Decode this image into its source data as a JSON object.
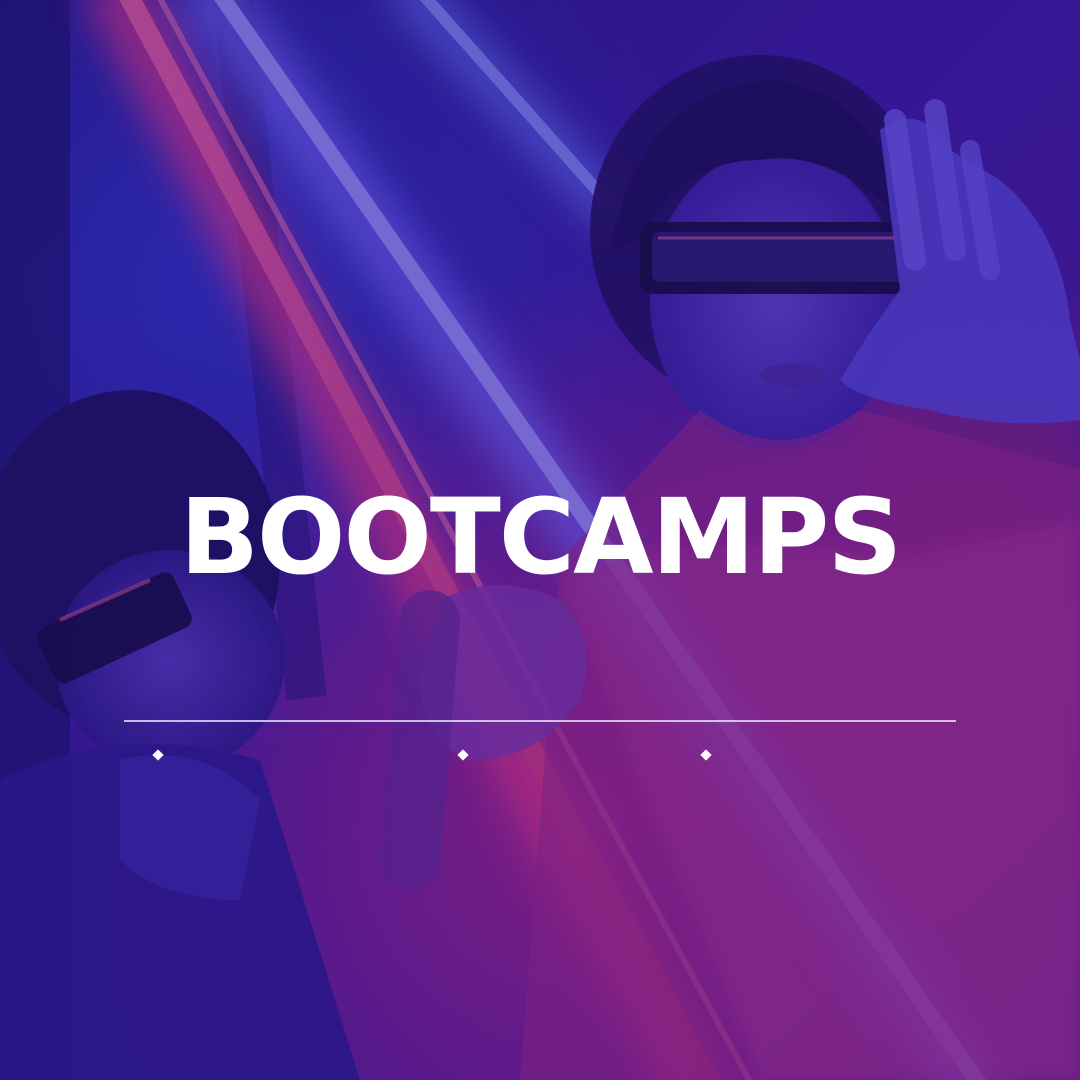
{
  "title": "BOOTCAMPS",
  "colors": {
    "overlay": "#3b1ea8",
    "neon_pink": "#e2327a",
    "neon_blue": "#5b6cff",
    "text": "#ffffff"
  },
  "decorations": {
    "divider": "thin-line",
    "bullets": [
      "diamond-icon",
      "diamond-icon",
      "diamond-icon"
    ]
  }
}
